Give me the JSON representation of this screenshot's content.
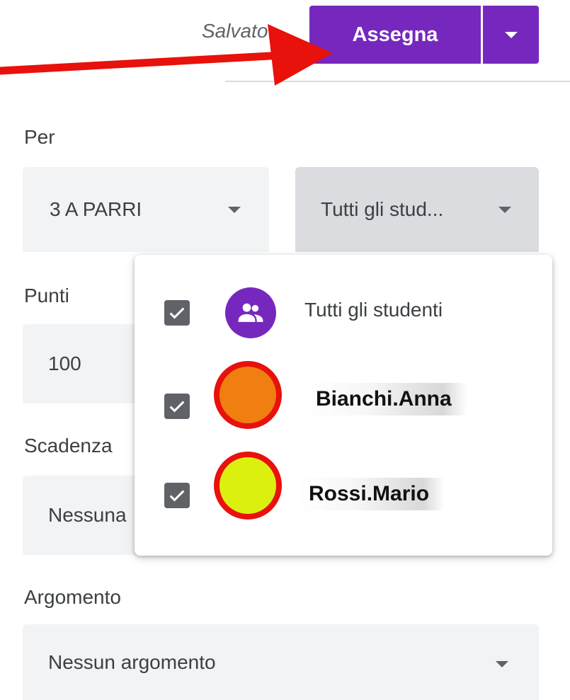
{
  "header": {
    "saved_status": "Salvato",
    "assign_label": "Assegna"
  },
  "sections": {
    "per_label": "Per",
    "punti_label": "Punti",
    "scadenza_label": "Scadenza",
    "argomento_label": "Argomento"
  },
  "fields": {
    "class_value": "3 A PARRI",
    "students_value": "Tutti gli stud...",
    "points_value": "100",
    "due_value": "Nessuna",
    "topic_value": "Nessun argomento"
  },
  "students_menu": {
    "all_students_label": "Tutti gli studenti",
    "items": [
      {
        "name": "Bianchi.Anna",
        "avatar_color": "#f07e10",
        "checked": true
      },
      {
        "name": "Rossi.Mario",
        "avatar_color": "#dcf010",
        "checked": true
      }
    ],
    "all_checked": true
  },
  "colors": {
    "accent": "#7628be",
    "annotation_red": "#e8110b"
  }
}
